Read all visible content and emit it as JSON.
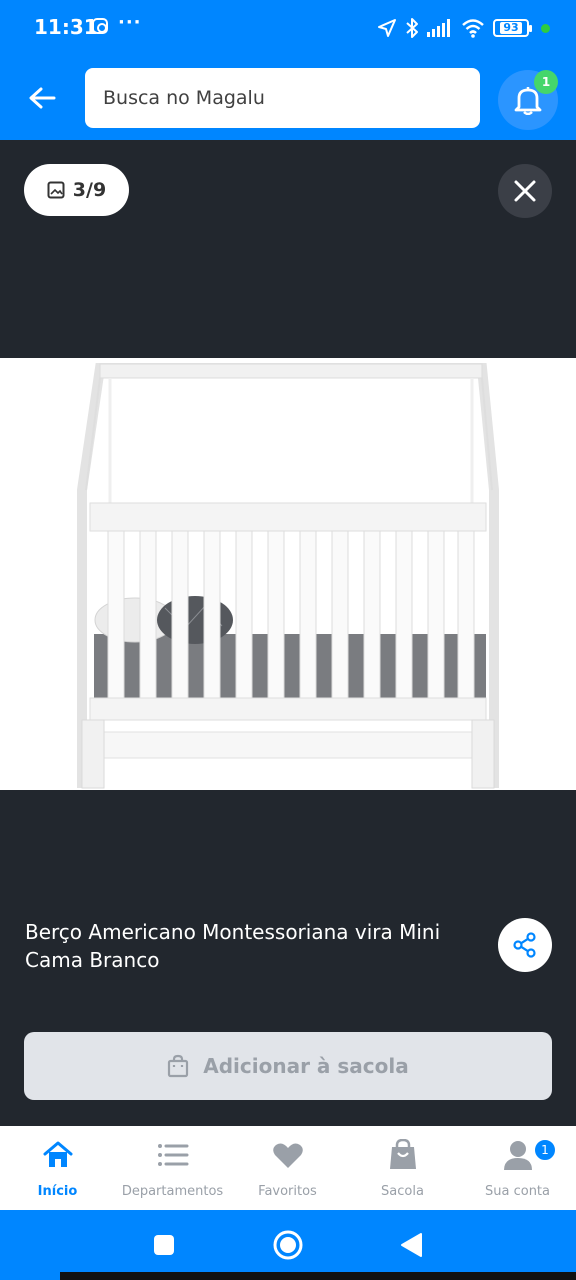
{
  "status_bar": {
    "time": "11:31",
    "dots": "···",
    "battery": "93"
  },
  "header": {
    "search_placeholder": "Busca no Magalu",
    "notification_count": "1"
  },
  "viewer": {
    "image_counter": "3/9"
  },
  "product": {
    "title": "Berço Americano Montessoriana vira Mini Cama Branco"
  },
  "actions": {
    "add_to_bag": "Adicionar à sacola"
  },
  "bottom_nav": {
    "items": [
      {
        "label": "Início",
        "icon": "home-icon",
        "active": true
      },
      {
        "label": "Departamentos",
        "icon": "list-icon",
        "active": false
      },
      {
        "label": "Favoritos",
        "icon": "heart-icon",
        "active": false
      },
      {
        "label": "Sacola",
        "icon": "bag-icon",
        "active": false
      },
      {
        "label": "Sua conta",
        "icon": "user-icon",
        "active": false
      }
    ],
    "account_badge": "1"
  },
  "colors": {
    "brand_blue": "#0086ff",
    "viewer_bg": "#22272e",
    "badge_green": "#45d66b"
  }
}
